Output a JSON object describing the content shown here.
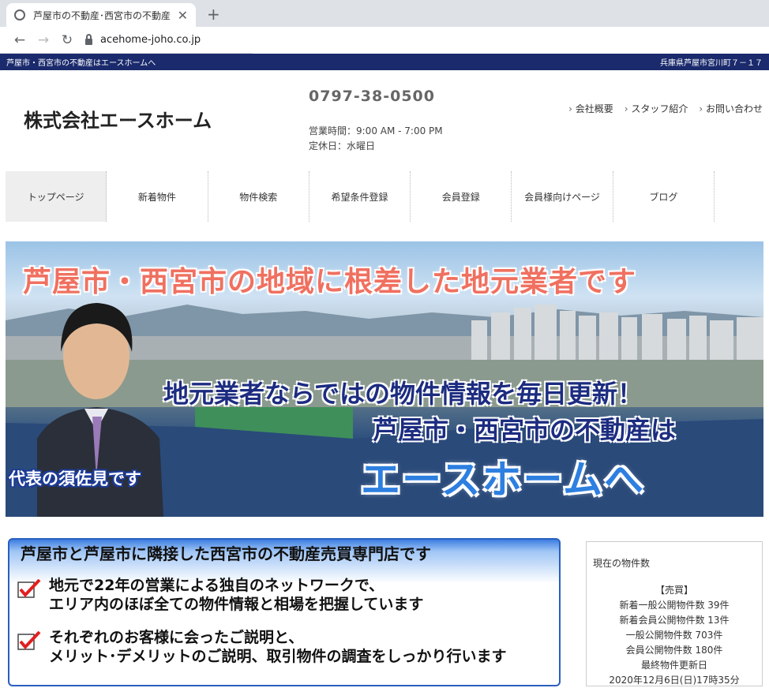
{
  "browser": {
    "tab_title": "芦屋市の不動産･西宮市の不動産",
    "url": "acehome-joho.co.jp"
  },
  "topbar": {
    "left": "芦屋市・西宮市の不動産はエースホームへ",
    "right": "兵庫県芦屋市宮川町７－１７"
  },
  "header": {
    "company": "株式会社エースホーム",
    "phone": "0797-38-0500",
    "hours": "営業時間：9:00 AM - 7:00 PM",
    "holiday": "定休日：水曜日",
    "links": [
      "会社概要",
      "スタッフ紹介",
      "お問い合わせ"
    ]
  },
  "nav": [
    "トップページ",
    "新着物件",
    "物件検索",
    "希望条件登録",
    "会員登録",
    "会員様向けページ",
    "ブログ"
  ],
  "banner": {
    "headline": "芦屋市・西宮市の地域に根差した地元業者です",
    "line1": "地元業者ならではの物件情報を毎日更新！",
    "line2": "芦屋市・西宮市の不動産は",
    "big": "エースホームへ",
    "representative": "代表の須佐見です"
  },
  "feature": {
    "title": "芦屋市と芦屋市に隣接した西宮市の不動産売買専門店です",
    "point1_a": "地元で22年の営業による独自のネットワークで、",
    "point1_b": "エリア内のほぼ全ての物件情報と相場を把握しています",
    "point2_a": "それぞれのお客様に会ったご説明と、",
    "point2_b": "メリット･デメリットのご説明、取引物件の調査をしっかり行います"
  },
  "sidebox": {
    "title": "現在の物件数",
    "section": "【売買】",
    "line1": "新着一般公開物件数 39件",
    "line2": "新着会員公開物件数 13件",
    "line3": "一般公開物件数 703件",
    "line4": "会員公開物件数 180件",
    "line5": "最終物件更新日",
    "line6": "2020年12月6日(日)17時35分"
  },
  "colors": {
    "topbar_bg": "#1a2a6c",
    "headline": "#f07060",
    "big_text": "#2d7fe0",
    "check": "#e02020"
  }
}
